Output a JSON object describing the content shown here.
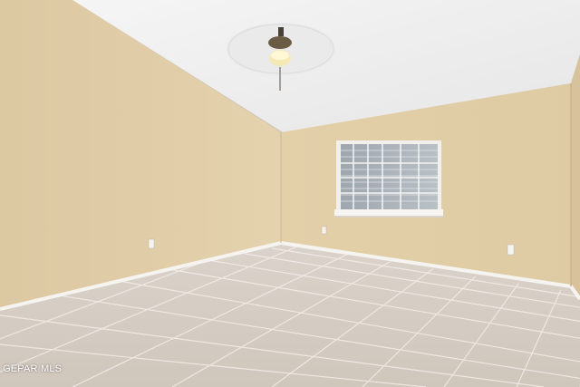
{
  "photo": {
    "watermark_text": "GEPAR MLS",
    "room": {
      "wall_color": "#e2cea7",
      "wall_shadow_color": "#d8c29a",
      "ceiling_color": "#efefef",
      "floor_tile_color": "#d6cdc4",
      "baseboard_color": "#f4f2ee"
    },
    "objects": [
      {
        "name": "ceiling-fan",
        "description_icon": "fan-icon"
      },
      {
        "name": "window",
        "description_icon": "window-icon"
      },
      {
        "name": "electrical-outlet-left-wall",
        "description_icon": "outlet-icon"
      },
      {
        "name": "electrical-outlet-back-wall-left",
        "description_icon": "outlet-icon"
      },
      {
        "name": "electrical-outlet-back-wall-right",
        "description_icon": "outlet-icon"
      }
    ]
  }
}
